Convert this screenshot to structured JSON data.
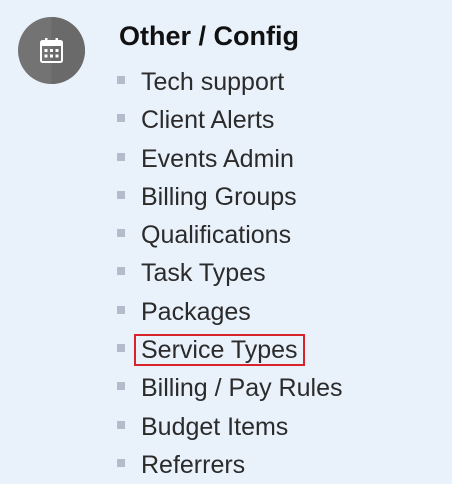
{
  "section": {
    "icon": "calendar-icon",
    "title": "Other / Config"
  },
  "menu": {
    "items": [
      {
        "label": "Tech support"
      },
      {
        "label": "Client Alerts"
      },
      {
        "label": "Events Admin"
      },
      {
        "label": "Billing Groups"
      },
      {
        "label": "Qualifications"
      },
      {
        "label": "Task Types"
      },
      {
        "label": "Packages"
      },
      {
        "label": "Service Types",
        "highlighted": true
      },
      {
        "label": "Billing / Pay Rules"
      },
      {
        "label": "Budget Items"
      },
      {
        "label": "Referrers"
      }
    ]
  },
  "colors": {
    "background": "#e9f1fb",
    "icon_circle": "#737373",
    "highlight_border": "#d9232b",
    "bullet": "#b3bccb",
    "text": "#2b2b2b"
  }
}
